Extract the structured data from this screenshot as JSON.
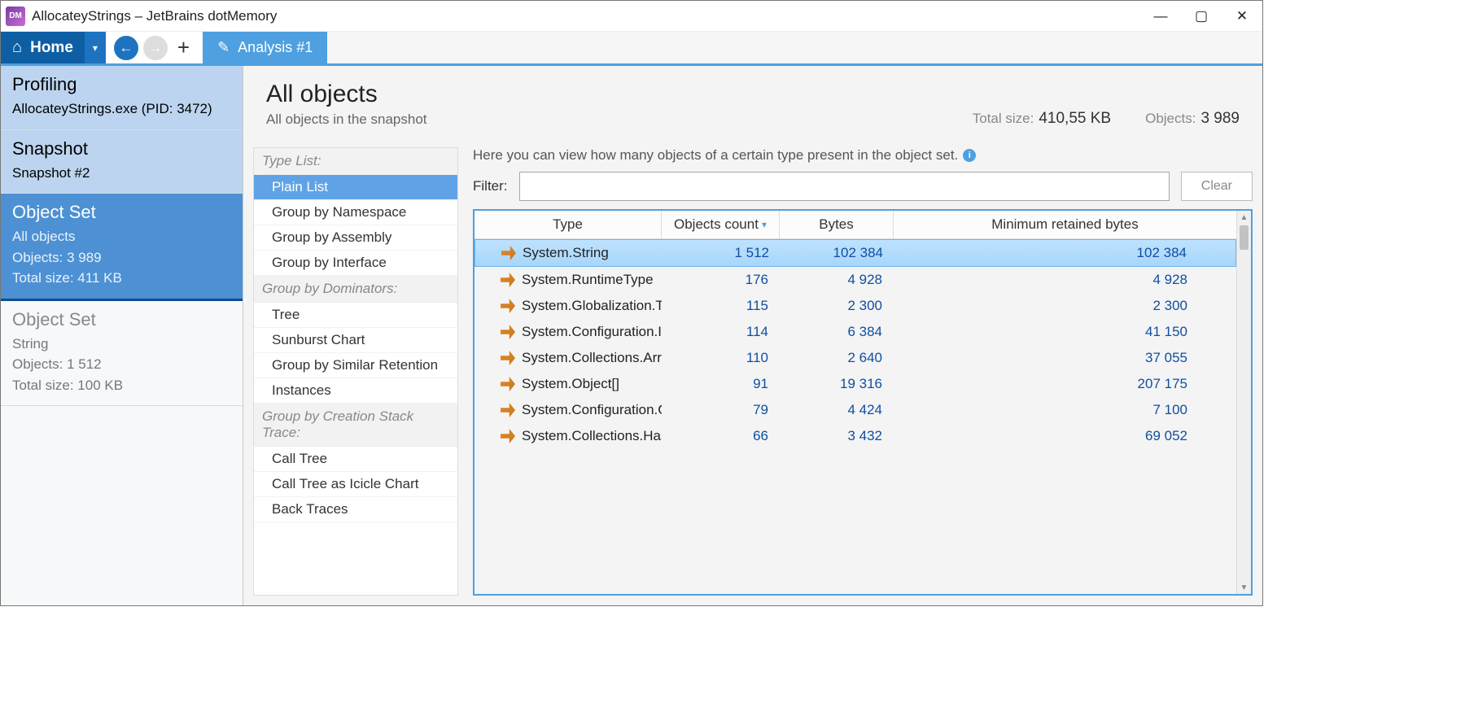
{
  "titlebar": {
    "text": "AllocateyStrings – JetBrains dotMemory"
  },
  "toolbar": {
    "home": "Home",
    "analysis_tab": "Analysis #1"
  },
  "sidebar": {
    "profiling": {
      "title": "Profiling",
      "line1": "AllocateyStrings.exe (PID: 3472)"
    },
    "snapshot": {
      "title": "Snapshot",
      "line1": "Snapshot #2"
    },
    "objectset_sel": {
      "title": "Object Set",
      "line1": "All objects",
      "line2": "Objects: 3 989",
      "line3": "Total size: 411 KB"
    },
    "objectset_dim": {
      "title": "Object Set",
      "line1": "String",
      "line2": "Objects: 1 512",
      "line3": "Total size: 100 KB"
    }
  },
  "header": {
    "title": "All objects",
    "subtitle": "All objects in the snapshot",
    "total_size_label": "Total size:",
    "total_size_value": "410,55 KB",
    "objects_label": "Objects:",
    "objects_value": "3 989"
  },
  "typelist": {
    "g1": "Type List:",
    "i1": "Plain List",
    "i2": "Group by Namespace",
    "i3": "Group by Assembly",
    "i4": "Group by Interface",
    "g2": "Group by Dominators:",
    "i5": "Tree",
    "i6": "Sunburst Chart",
    "i7": "Group by Similar Retention",
    "i8": "Instances",
    "g3": "Group by Creation Stack Trace:",
    "i9": "Call Tree",
    "i10": "Call Tree as Icicle Chart",
    "i11": "Back Traces"
  },
  "hint": "Here you can view how many objects of a certain type present in the object set.",
  "filter": {
    "label": "Filter:",
    "clear": "Clear"
  },
  "grid": {
    "cols": {
      "type": "Type",
      "count": "Objects count",
      "bytes": "Bytes",
      "retained": "Minimum retained bytes"
    },
    "rows": [
      {
        "type": "System.String",
        "count": "1 512",
        "bytes": "102 384",
        "retained": "102 384",
        "sel": true
      },
      {
        "type": "System.RuntimeType",
        "count": "176",
        "bytes": "4 928",
        "retained": "4 928"
      },
      {
        "type": "System.Globalization.T",
        "count": "115",
        "bytes": "2 300",
        "retained": "2 300"
      },
      {
        "type": "System.Configuration.I",
        "count": "114",
        "bytes": "6 384",
        "retained": "41 150"
      },
      {
        "type": "System.Collections.Arr",
        "count": "110",
        "bytes": "2 640",
        "retained": "37 055"
      },
      {
        "type": "System.Object[]",
        "count": "91",
        "bytes": "19 316",
        "retained": "207 175"
      },
      {
        "type": "System.Configuration.C",
        "count": "79",
        "bytes": "4 424",
        "retained": "7 100"
      },
      {
        "type": "System.Collections.Has",
        "count": "66",
        "bytes": "3 432",
        "retained": "69 052"
      }
    ]
  }
}
